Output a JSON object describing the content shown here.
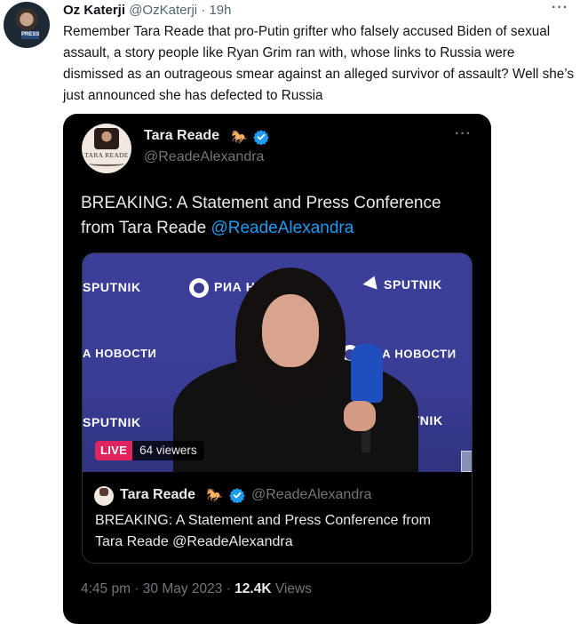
{
  "outer_tweet": {
    "name": "Oz Katerji",
    "handle": "@OzKaterji",
    "separator": "·",
    "time": "19h",
    "more_label": "···",
    "avatar_badge": "PRESS",
    "text": "Remember Tara Reade that pro-Putin grifter who falsely accused Biden of sexual assault, a story people like Ryan Grim ran with, whose links to Russia were dismissed as an outrageous smear against an alleged survivor of assault? Well she’s just announced she has defected to Russia"
  },
  "quoted_tweet": {
    "name": "Tara Reade",
    "handle": "@ReadeAlexandra",
    "more_label": "···",
    "avatar_brand": "TARA READE",
    "text_main": "BREAKING: A Statement and Press Conference from Tara Reade ",
    "text_mention": "@ReadeAlexandra",
    "meta_time": "4:45 pm · 30 May 2023 · ",
    "meta_views_count": "12.4K",
    "meta_views_label": " Views"
  },
  "media": {
    "backdrop_sputnik": "SPUTNIK",
    "backdrop_sputnik_partial": "PUTNIK",
    "backdrop_ria_partial_top": "РИА Н",
    "backdrop_ria_left": "А НОВОСТИ",
    "backdrop_ria_right": "РИА НОВОСТИ",
    "live_label": "LIVE",
    "viewers": "64 viewers",
    "card_name": "Tara Reade",
    "card_handle": "@ReadeAlexandra",
    "card_text": "BREAKING: A Statement and Press Conference from Tara Reade @ReadeAlexandra"
  },
  "icons": {
    "horse": "🐎",
    "verified": "verified-badge-icon"
  },
  "colors": {
    "link": "#1d9bf0",
    "verified": "#1d9bf0",
    "live": "#e0245e",
    "card_bg": "#000000"
  }
}
